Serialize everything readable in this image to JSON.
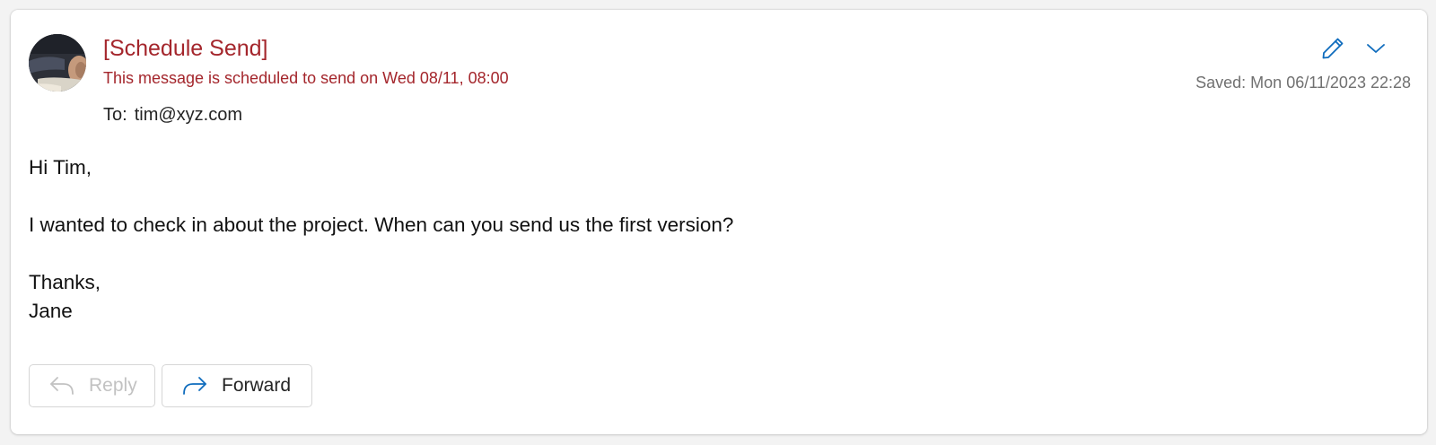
{
  "message": {
    "subject": "[Schedule Send]",
    "schedule_notice": "This message is scheduled to send on Wed 08/11, 08:00",
    "to_label": "To:",
    "to_value": "tim@xyz.com",
    "saved": "Saved: Mon 06/11/2023 22:28"
  },
  "header_actions": {
    "edit_icon": "pencil-icon",
    "more_icon": "chevron-down-icon"
  },
  "body": {
    "greeting": "Hi Tim,",
    "paragraph": "I wanted to check in about the project. When can you send us the first version?",
    "closing": "Thanks,",
    "signature": "Jane"
  },
  "footer": {
    "reply_label": "Reply",
    "reply_icon": "reply-arrow-icon",
    "forward_label": "Forward",
    "forward_icon": "forward-arrow-icon"
  },
  "colors": {
    "warning_red": "#a4262c",
    "accent_blue": "#0f6cbd",
    "muted_gray": "#707070",
    "disabled_gray": "#c2c2c2"
  }
}
